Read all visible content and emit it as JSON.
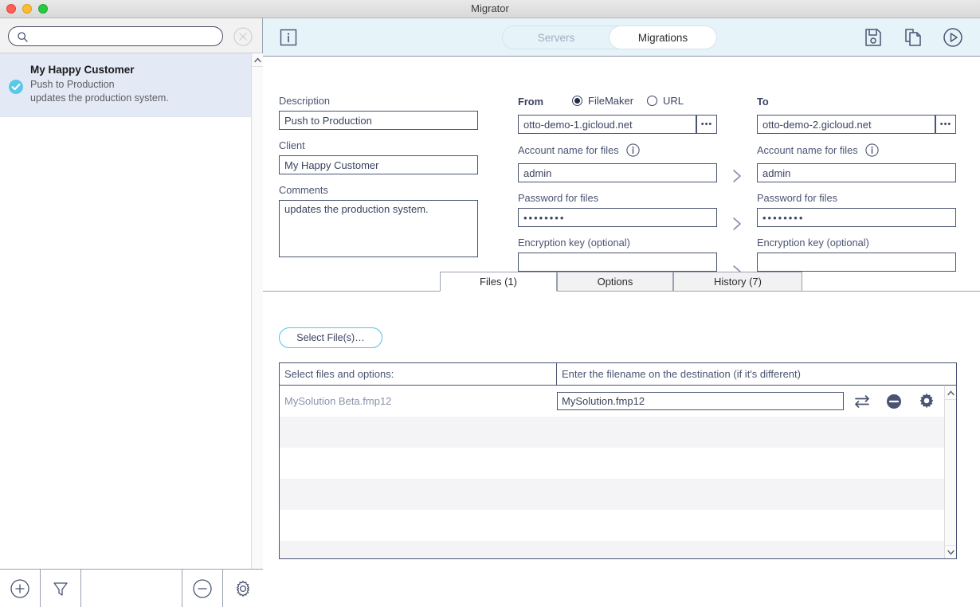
{
  "window": {
    "title": "Migrator",
    "traffic_lights": [
      "close",
      "minimize",
      "zoom"
    ]
  },
  "sidebar": {
    "search": {
      "value": "",
      "placeholder": "",
      "icon": "search-icon"
    },
    "clear_icon": "clear-circle-x-icon",
    "items": [
      {
        "title": "My Happy Customer",
        "line2": "Push to Production",
        "line3": "updates the production system.",
        "status_icon": "check-circle-icon",
        "selected": true
      }
    ],
    "bottom_toolbar": [
      {
        "name": "add-button",
        "icon": "plus-circle-icon"
      },
      {
        "name": "filter-button",
        "icon": "funnel-icon"
      },
      {
        "name": "remove-button",
        "icon": "minus-circle-icon"
      },
      {
        "name": "settings-button",
        "icon": "gear-icon"
      }
    ],
    "scroll": {
      "up_icon": "chevron-up-icon",
      "down_icon": "chevron-down-icon"
    }
  },
  "toolbar": {
    "info_icon": "info-box-icon",
    "segments": [
      {
        "label": "Servers",
        "active": false
      },
      {
        "label": "Migrations",
        "active": true
      }
    ],
    "actions": [
      {
        "name": "save-button",
        "icon": "floppy-save-icon"
      },
      {
        "name": "duplicate-button",
        "icon": "copy-pages-icon"
      },
      {
        "name": "run-button",
        "icon": "play-circle-icon"
      }
    ]
  },
  "form": {
    "description_label": "Description",
    "description_value": "Push to Production",
    "client_label": "Client",
    "client_value": "My Happy Customer",
    "comments_label": "Comments",
    "comments_value": "updates the production system.",
    "from": {
      "heading": "From",
      "source_options": [
        {
          "label": "FileMaker",
          "selected": true
        },
        {
          "label": "URL",
          "selected": false
        }
      ],
      "host_value": "otto-demo-1.gicloud.net",
      "browse_label": "•••",
      "account_label": "Account name for files",
      "account_info_icon": "info-circle-icon",
      "account_value": "admin",
      "password_label": "Password for files",
      "password_value": "••••••••",
      "encryption_label": "Encryption key (optional)",
      "encryption_value": ""
    },
    "to": {
      "heading": "To",
      "host_value": "otto-demo-2.gicloud.net",
      "browse_label": "•••",
      "account_label": "Account name for files",
      "account_info_icon": "info-circle-icon",
      "account_value": "admin",
      "password_label": "Password for files",
      "password_value": "••••••••",
      "encryption_label": "Encryption key (optional)",
      "encryption_value": ""
    },
    "chevron_icon": "chevron-right-icon"
  },
  "tabs": [
    {
      "label": "Files (1)",
      "active": true
    },
    {
      "label": "Options",
      "active": false
    },
    {
      "label": "History (7)",
      "active": false
    }
  ],
  "files_panel": {
    "select_files_label": "Select File(s)…",
    "columns": [
      "Select files and options:",
      "Enter the filename on the destination (if it's different)"
    ],
    "rows": [
      {
        "source_name": "MySolution Beta.fmp12",
        "dest_value": "MySolution.fmp12",
        "icons": [
          {
            "name": "swap-arrows-icon"
          },
          {
            "name": "remove-circle-icon"
          },
          {
            "name": "gear-icon"
          }
        ]
      }
    ],
    "empty_row_count": 6,
    "scroll": {
      "up_icon": "chevron-up-icon",
      "down_icon": "chevron-down-icon"
    }
  },
  "colors": {
    "toolbar_bg": "#e6f3f9",
    "accent_cyan": "#4fc3e8",
    "text_navy": "#3b4460",
    "selected_row": "#e3eaf6",
    "zebra": "#f4f4f6"
  }
}
